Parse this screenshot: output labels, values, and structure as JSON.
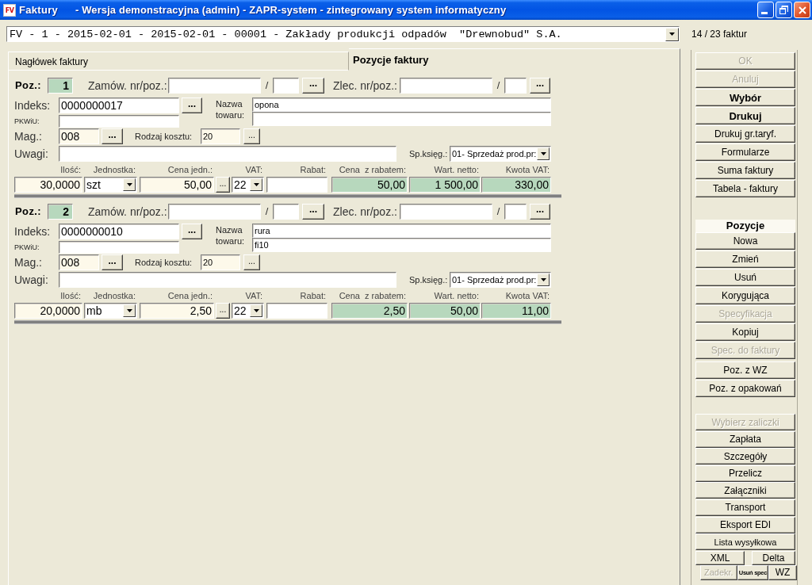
{
  "window": {
    "logo": "FV",
    "title": "Faktury",
    "subtitle": "- Wersja demonstracyjna (admin) - ZAPR-system - zintegrowany system informatyczny"
  },
  "record": {
    "value": "FV - 1 - 2015-02-01 - 2015-02-01 - 00001 - Zakłady produkcji odpadów  \"Drewnobud\" S.A.",
    "counter": "14 / 23 faktur"
  },
  "tabs": [
    {
      "label": "Nagłówek faktury",
      "selected": false
    },
    {
      "label": "Pozycje faktury",
      "selected": true
    }
  ],
  "positions": [
    {
      "number_label": "Poz.:",
      "number": "1",
      "order": {
        "label": "Zamów. nr/poz.:",
        "separator": "/",
        "button": "..."
      },
      "job": {
        "label": "Zlec. nr/poz.:",
        "separator": "/",
        "button": "..."
      },
      "index": {
        "label": "Indeks:",
        "value": "0000000017",
        "button": "..."
      },
      "pkwiu": {
        "label": "PKWiU:"
      },
      "product_name": {
        "label": "Nazwa towaru:",
        "line_1": "opona"
      },
      "warehouse": {
        "label": "Mag.:",
        "value": "008",
        "button": "..."
      },
      "cost_type": {
        "label": "Rodzaj kosztu:",
        "value": "20",
        "button": "..."
      },
      "notes": {
        "label": "Uwagi:"
      },
      "account": {
        "label": "Sp.księg.:",
        "value": "01- Sprzedaż prod.pr:"
      },
      "line": [
        {
          "label": "Ilość:",
          "value": "30,0000",
          "kind": "entry"
        },
        {
          "label": "Jednostka:",
          "value": "szt",
          "kind": "select"
        },
        {
          "label": "Cena jedn.:",
          "value": "50,00",
          "kind": "entry",
          "button": "..."
        },
        {
          "label": "VAT:",
          "value": "22",
          "kind": "select"
        },
        {
          "label": "Rabat:",
          "kind": "plain"
        },
        {
          "label": "Cena  z rabatem:",
          "value": "50,00",
          "kind": "computed"
        },
        {
          "label": "Wart. netto:",
          "value": "1 500,00",
          "kind": "computed"
        },
        {
          "label": "Kwota VAT:",
          "value": "330,00",
          "kind": "computed"
        }
      ]
    },
    {
      "number_label": "Poz.:",
      "number": "2",
      "order": {
        "label": "Zamów. nr/poz.:",
        "separator": "/",
        "button": "..."
      },
      "job": {
        "label": "Zlec. nr/poz.:",
        "separator": "/",
        "button": "..."
      },
      "index": {
        "label": "Indeks:",
        "value": "0000000010",
        "button": "..."
      },
      "pkwiu": {
        "label": "PKWiU:"
      },
      "product_name": {
        "label": "Nazwa towaru:",
        "line_1": "rura",
        "line_2": "fi10"
      },
      "warehouse": {
        "label": "Mag.:",
        "value": "008",
        "button": "..."
      },
      "cost_type": {
        "label": "Rodzaj kosztu:",
        "value": "20",
        "button": "..."
      },
      "notes": {
        "label": "Uwagi:"
      },
      "account": {
        "label": "Sp.księg.:",
        "value": "01- Sprzedaż prod.pr:"
      },
      "line": [
        {
          "label": "Ilość:",
          "value": "20,0000",
          "kind": "entry"
        },
        {
          "label": "Jednostka:",
          "value": "mb",
          "kind": "select"
        },
        {
          "label": "Cena jedn.:",
          "value": "2,50",
          "kind": "entry",
          "button": "..."
        },
        {
          "label": "VAT:",
          "value": "22",
          "kind": "select"
        },
        {
          "label": "Rabat:",
          "kind": "plain"
        },
        {
          "label": "Cena  z rabatem:",
          "value": "2,50",
          "kind": "computed"
        },
        {
          "label": "Wart. netto:",
          "value": "50,00",
          "kind": "computed"
        },
        {
          "label": "Kwota VAT:",
          "value": "11,00",
          "kind": "computed"
        }
      ]
    }
  ],
  "sidebar": {
    "groups": [
      {
        "buttons": [
          {
            "label": "OK",
            "disabled": true,
            "kind": "plain"
          },
          {
            "label": "Anuluj",
            "disabled": true,
            "kind": "plain"
          },
          {
            "label": "Wybór",
            "disabled": false,
            "kind": "bold"
          },
          {
            "label": "Drukuj",
            "disabled": false,
            "kind": "bold"
          },
          {
            "label": "Drukuj gr.taryf.",
            "disabled": false,
            "kind": "plain"
          },
          {
            "label": "Formularze",
            "disabled": false,
            "kind": "plain"
          },
          {
            "label": "Suma faktury",
            "disabled": false,
            "kind": "plain"
          },
          {
            "label": "Tabela - faktury",
            "disabled": false,
            "kind": "plain"
          }
        ]
      },
      {
        "header": "Pozycje",
        "buttons": [
          {
            "label": "Nowa",
            "disabled": false,
            "kind": "plain"
          },
          {
            "label": "Zmień",
            "disabled": false,
            "kind": "plain"
          },
          {
            "label": "Usuń",
            "disabled": false,
            "kind": "plain"
          },
          {
            "label": "Korygująca",
            "disabled": false,
            "kind": "plain"
          },
          {
            "label": "Specyfikacja",
            "disabled": true,
            "kind": "plain"
          },
          {
            "label": "Kopiuj",
            "disabled": false,
            "kind": "plain"
          },
          {
            "label": "Spec. do faktury",
            "disabled": true,
            "kind": "plain"
          }
        ]
      },
      {
        "buttons": [
          {
            "label": "Poz. z WZ",
            "disabled": false,
            "kind": "plain"
          },
          {
            "label": "Poz. z opakowań",
            "disabled": false,
            "kind": "plain"
          }
        ]
      },
      {
        "buttons": [
          {
            "label": "Wybierz zaliczki",
            "disabled": true,
            "kind": "plain"
          },
          {
            "label": "Zapłata",
            "disabled": false,
            "kind": "plain"
          },
          {
            "label": "Szczegóły",
            "disabled": false,
            "kind": "plain"
          },
          {
            "label": "Przelicz",
            "disabled": false,
            "kind": "plain"
          },
          {
            "label": "Załączniki",
            "disabled": false,
            "kind": "plain"
          },
          {
            "label": "Transport",
            "disabled": false,
            "kind": "plain"
          },
          {
            "label": "Eksport EDI",
            "disabled": false,
            "kind": "plain"
          },
          {
            "label": "Lista wysyłkowa",
            "disabled": false,
            "kind": "small"
          }
        ]
      }
    ],
    "bottom_rows": [
      [
        {
          "label": "XML",
          "disabled": false,
          "kind": "plain"
        },
        {
          "label": "Delta",
          "disabled": false,
          "kind": "plain"
        }
      ],
      [
        {
          "label": "Zadekr.",
          "disabled": true,
          "kind": "small"
        },
        {
          "label": "Usuń spec",
          "disabled": false,
          "kind": "tiny"
        },
        {
          "label": "WZ",
          "disabled": false,
          "kind": "plain"
        }
      ]
    ]
  }
}
